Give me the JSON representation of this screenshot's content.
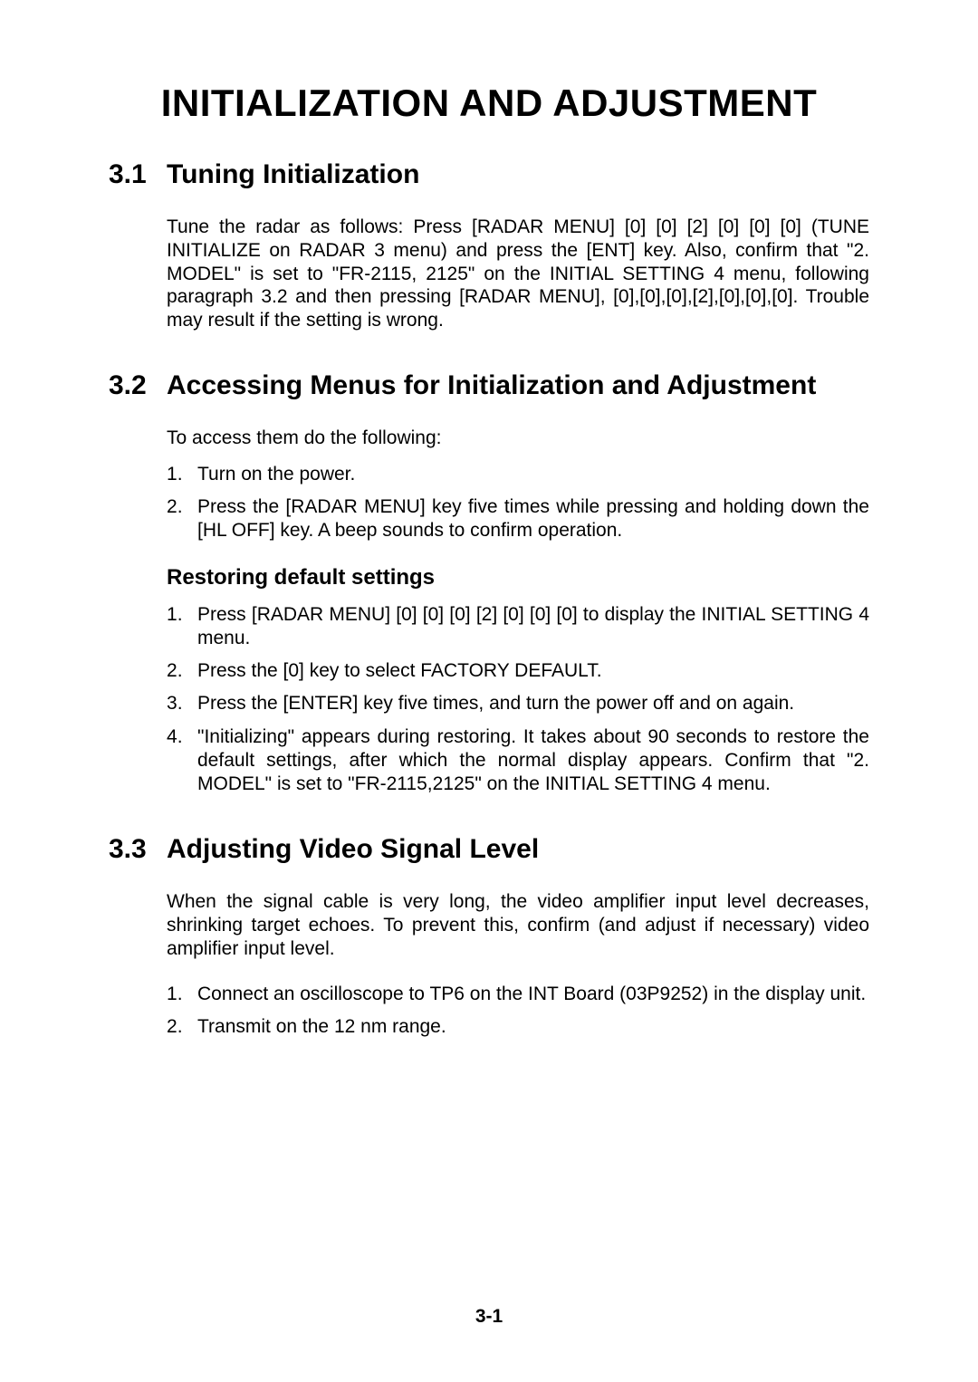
{
  "page": {
    "main_title": "INITIALIZATION AND ADJUSTMENT",
    "page_number": "3-1"
  },
  "sections": {
    "s31": {
      "num": "3.1",
      "title": "Tuning Initialization",
      "para": "Tune the radar as follows: Press [RADAR MENU] [0] [0] [2] [0] [0] [0] (TUNE INITIALIZE on RADAR 3 menu) and press the [ENT] key. Also, confirm that \"2. MODEL\" is set to \"FR-2115, 2125\" on the INITIAL SETTING 4 menu, following paragraph 3.2 and then pressing [RADAR  MENU], [0],[0],[0],[2],[0],[0],[0]. Trouble may result if the setting is wrong."
    },
    "s32": {
      "num": "3.2",
      "title": "Accessing Menus for Initialization and Adjustment",
      "intro": "To access them do the following:",
      "list1": [
        "Turn on the power.",
        "Press the [RADAR MENU] key five times while pressing and holding down the [HL OFF] key. A beep sounds to confirm operation."
      ],
      "sub_title": "Restoring default settings",
      "list2": [
        "Press [RADAR MENU] [0] [0] [0] [2] [0] [0] [0] to display the INITIAL SETTING 4 menu.",
        "Press the [0] key to select FACTORY DEFAULT.",
        "Press the [ENTER] key five times, and turn the power off and on again.",
        "\"Initializing\" appears during restoring. It takes about 90 seconds to restore the default settings, after which the normal display appears. Confirm that \"2. MODEL\" is set to \"FR-2115,2125\" on the INITIAL SETTING  4 menu."
      ]
    },
    "s33": {
      "num": "3.3",
      "title": "Adjusting Video Signal Level",
      "para": "When the signal cable is very long, the video amplifier input level decreases, shrinking target echoes. To prevent this, confirm (and adjust if necessary) video amplifier input level.",
      "list": [
        "Connect an oscilloscope to TP6 on the INT Board (03P9252) in the display unit.",
        "Transmit on the 12 nm range."
      ]
    }
  }
}
